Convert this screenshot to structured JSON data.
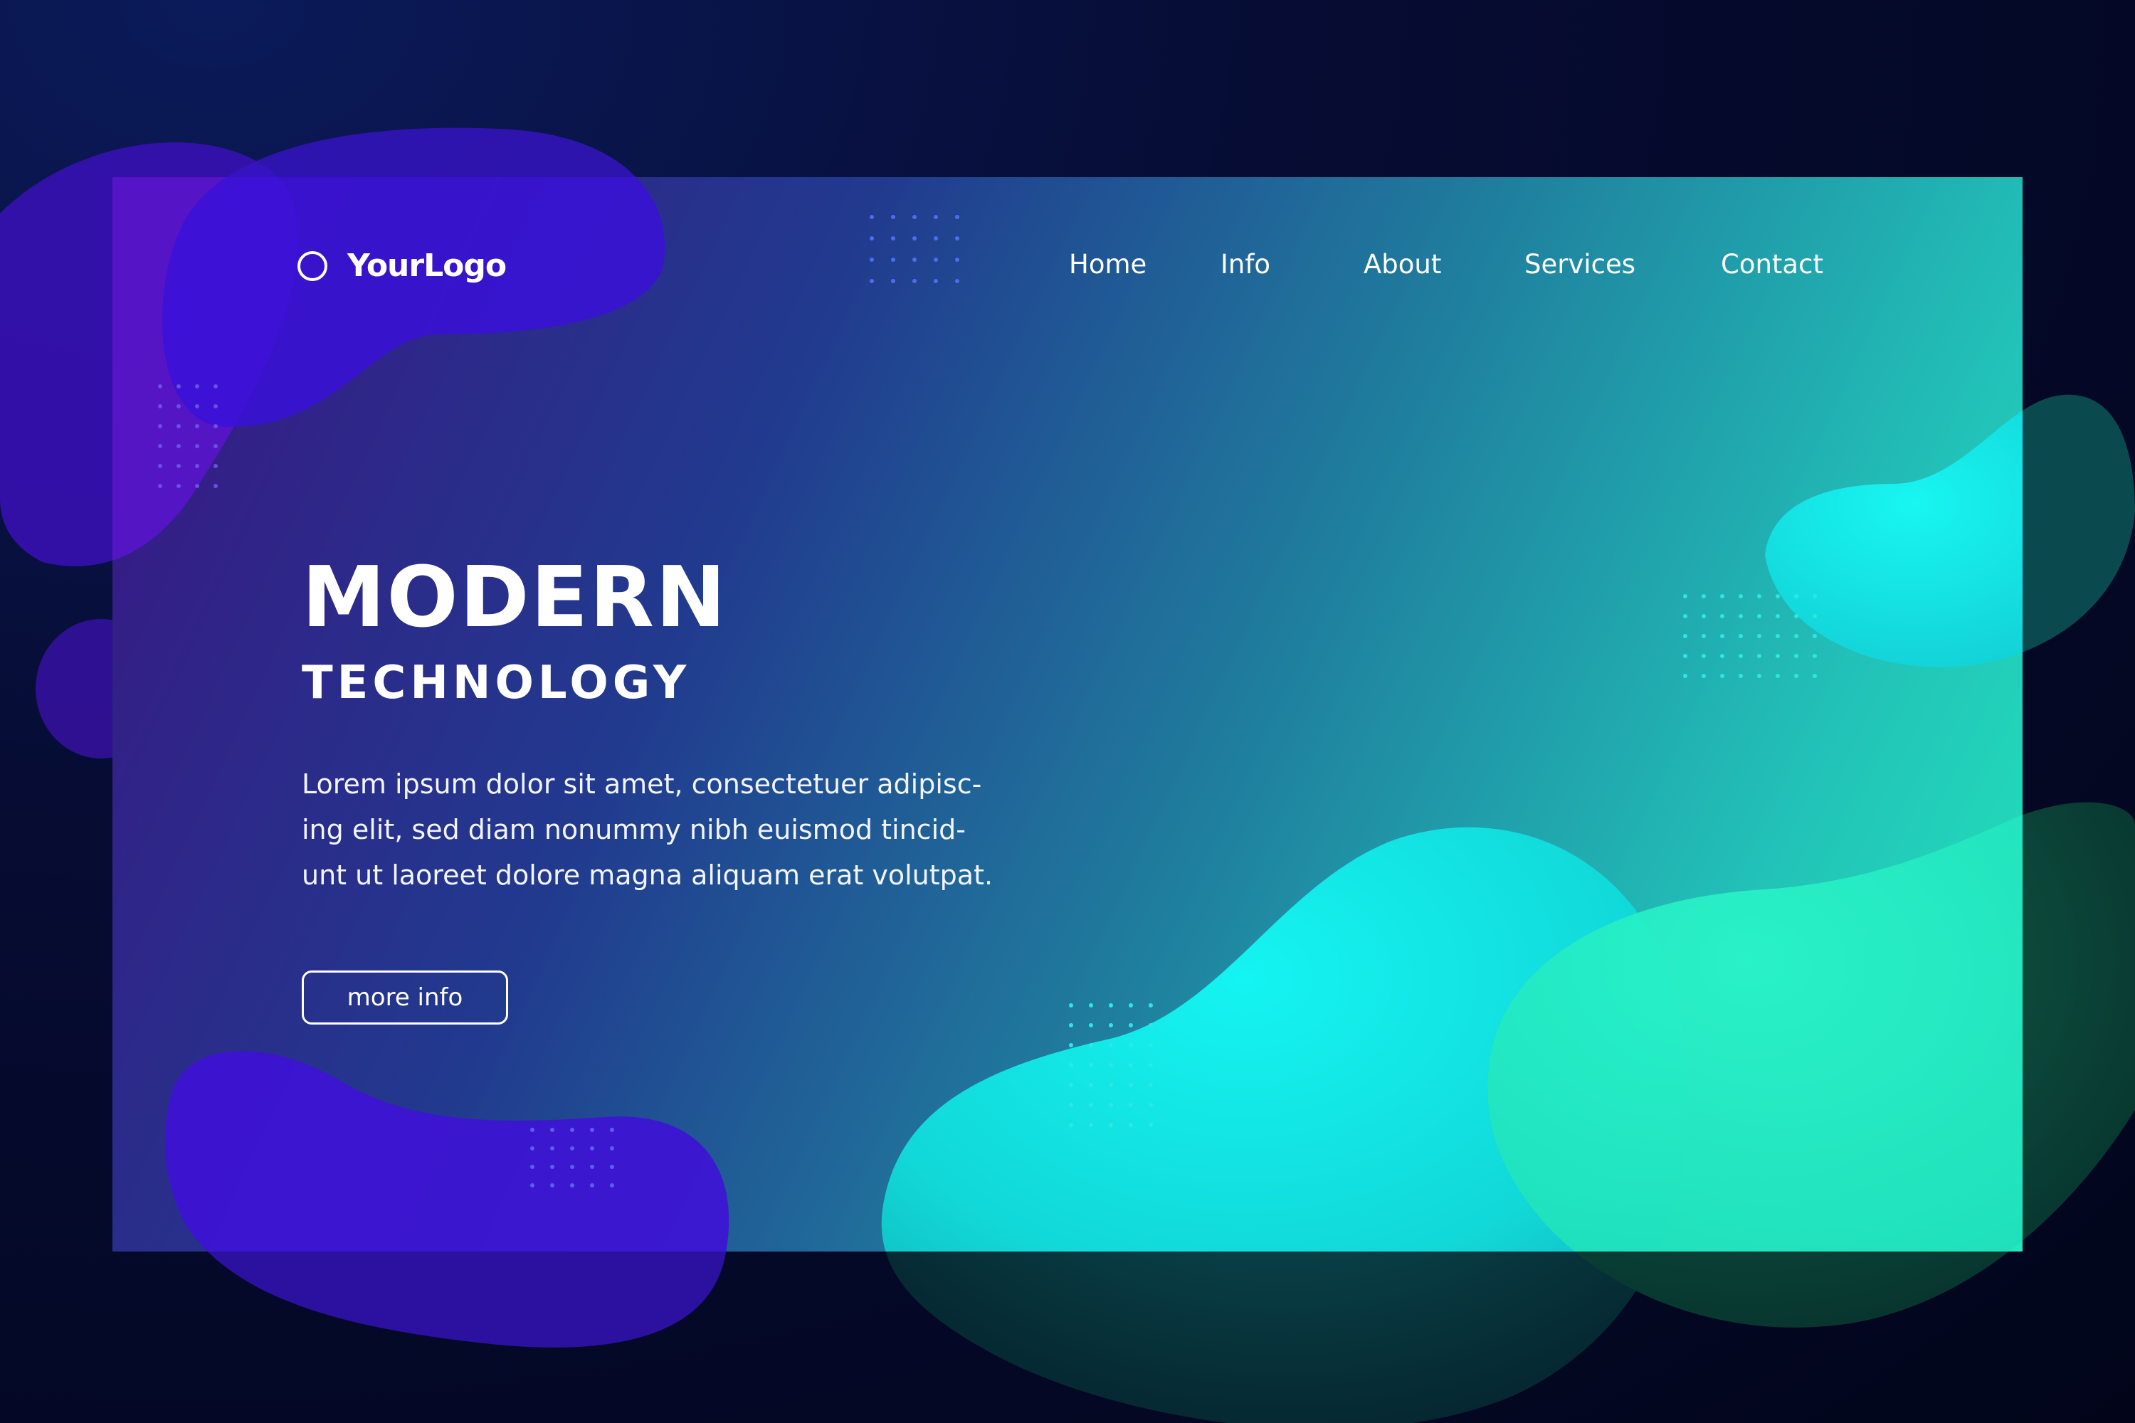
{
  "logo": {
    "text": "YourLogo",
    "icon": "circle-logo-icon"
  },
  "nav": {
    "items": [
      {
        "label": "Home"
      },
      {
        "label": "Info"
      },
      {
        "label": "About"
      },
      {
        "label": "Services"
      },
      {
        "label": "Contact"
      }
    ]
  },
  "hero": {
    "headline": "MODERN",
    "subheadline": "TECHNOLOGY",
    "body_lines": [
      "Lorem ipsum dolor sit amet, consectetuer adipisc-",
      "ing elit, sed diam nonummy nibh euismod tincid-",
      "unt ut laoreet dolore magna aliquam erat volutpat."
    ],
    "cta_label": "more info"
  },
  "colors": {
    "accent_purple": "#4a1ed8",
    "accent_cyan": "#10f2f0",
    "accent_mint": "#22f2bf",
    "background_dark": "#02051a"
  }
}
